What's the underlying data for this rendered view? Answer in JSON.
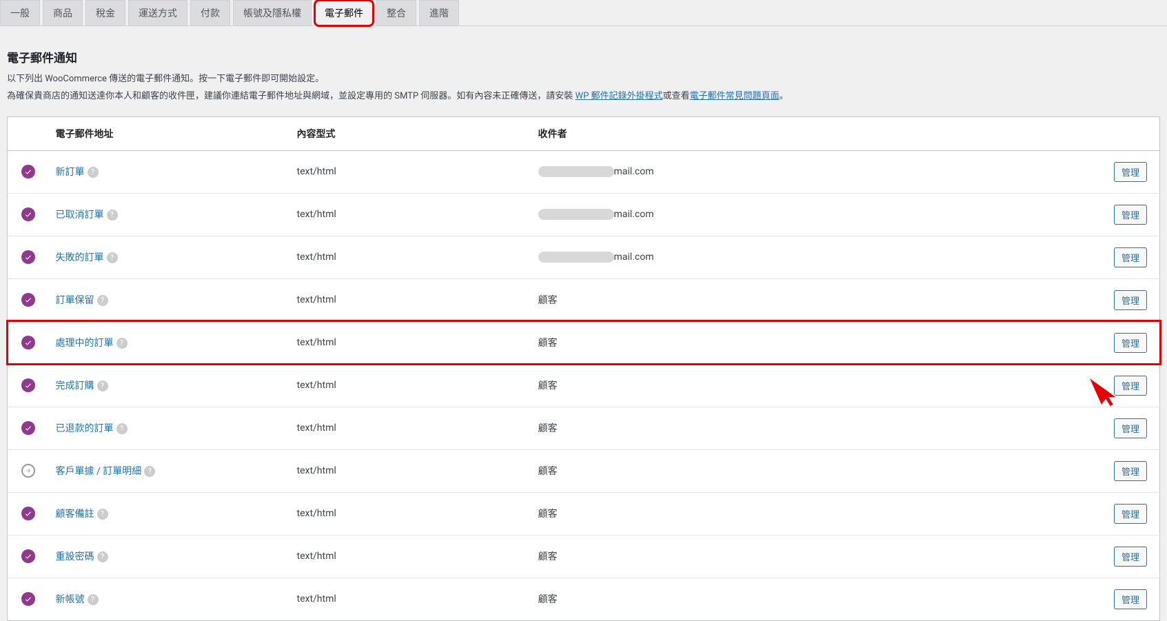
{
  "tabs": [
    {
      "label": "一般"
    },
    {
      "label": "商品"
    },
    {
      "label": "稅金"
    },
    {
      "label": "運送方式"
    },
    {
      "label": "付款"
    },
    {
      "label": "帳號及隱私權"
    },
    {
      "label": "電子郵件",
      "active": true,
      "highlighted": true
    },
    {
      "label": "整合"
    },
    {
      "label": "進階"
    }
  ],
  "heading": "電子郵件通知",
  "description_part1": "以下列出 WooCommerce 傳送的電子郵件通知。按一下電子郵件即可開始設定。",
  "description_part2_a": "為確保貴商店的通知送達你本人和顧客的收件匣，建議你連結電子郵件地址與網域，並設定專用的 SMTP 伺服器。如有內容未正確傳送，請安裝 ",
  "description_link1": "WP 郵件記錄外掛程式",
  "description_part2_b": "或查看",
  "description_link2": "電子郵件常見問題頁面",
  "description_part2_c": "。",
  "table": {
    "headers": {
      "status": "",
      "name": "電子郵件地址",
      "ctype": "內容型式",
      "recipient": "收件者",
      "actions": ""
    },
    "manage_label": "管理",
    "rows": [
      {
        "status": "enabled",
        "name": "新訂單",
        "ctype": "text/html",
        "recipient_redacted": true,
        "recipient_tail": "mail.com"
      },
      {
        "status": "enabled",
        "name": "已取消訂單",
        "ctype": "text/html",
        "recipient_redacted": true,
        "recipient_tail": "mail.com"
      },
      {
        "status": "enabled",
        "name": "失敗的訂單",
        "ctype": "text/html",
        "recipient_redacted": true,
        "recipient_tail": "mail.com"
      },
      {
        "status": "enabled",
        "name": "訂單保留",
        "ctype": "text/html",
        "recipient": "顧客"
      },
      {
        "status": "enabled",
        "name": "處理中的訂單",
        "ctype": "text/html",
        "recipient": "顧客",
        "highlight": true
      },
      {
        "status": "enabled",
        "name": "完成訂購",
        "ctype": "text/html",
        "recipient": "顧客"
      },
      {
        "status": "enabled",
        "name": "已退款的訂單",
        "ctype": "text/html",
        "recipient": "顧客"
      },
      {
        "status": "manual",
        "name": "客戶單據 / 訂單明細",
        "ctype": "text/html",
        "recipient": "顧客"
      },
      {
        "status": "enabled",
        "name": "顧客備註",
        "ctype": "text/html",
        "recipient": "顧客"
      },
      {
        "status": "enabled",
        "name": "重設密碼",
        "ctype": "text/html",
        "recipient": "顧客"
      },
      {
        "status": "enabled",
        "name": "新帳號",
        "ctype": "text/html",
        "recipient": "顧客"
      }
    ]
  }
}
